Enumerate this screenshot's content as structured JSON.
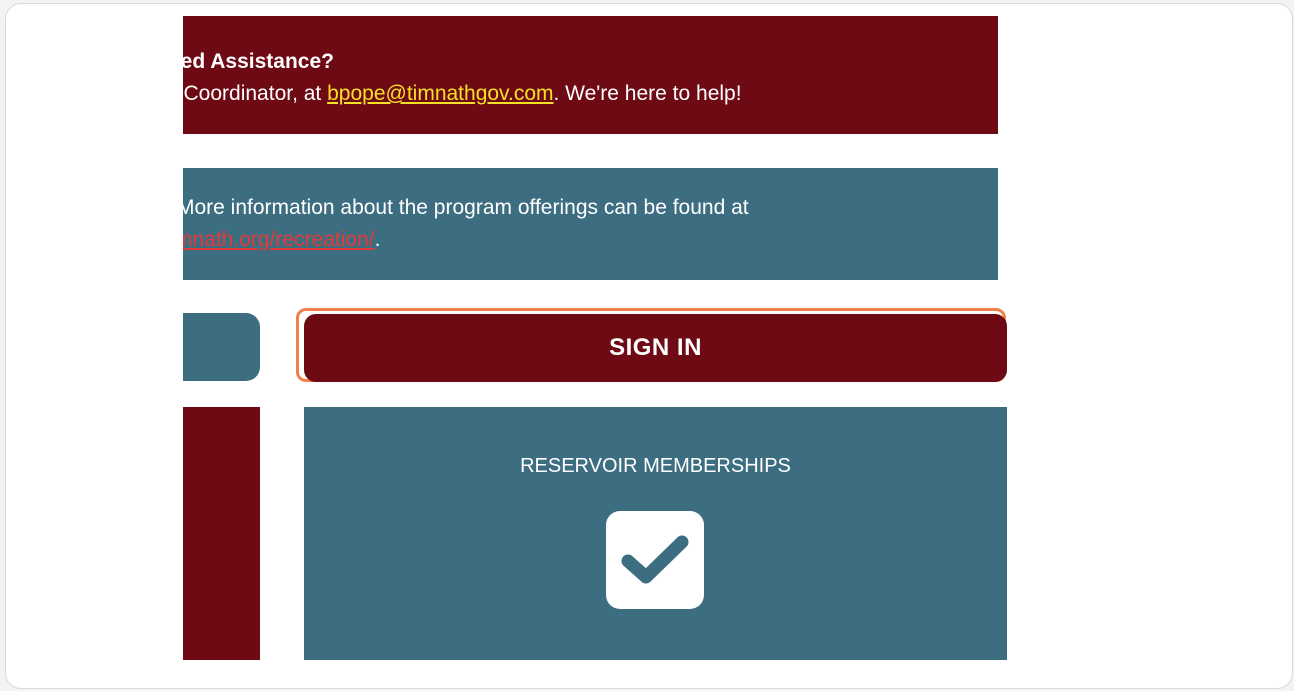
{
  "assistance": {
    "title": "eed Assistance?",
    "text_before": "n Coordinator, at ",
    "email": "bpope@timnathgov.com",
    "text_after": ". We're here to help!"
  },
  "info": {
    "line1": "More information about the program offerings can be found at",
    "link": "mnath.org/recreation/",
    "link_after": "."
  },
  "signin": {
    "label": "SIGN IN"
  },
  "reservoir": {
    "label": "RESERVOIR MEMBERSHIPS",
    "icon": "checkbox-check-icon"
  },
  "colors": {
    "maroon": "#6e0a14",
    "teal": "#3d6d80",
    "highlight": "#f08049",
    "email_link": "#f5e028",
    "info_link": "#e23a3a"
  }
}
